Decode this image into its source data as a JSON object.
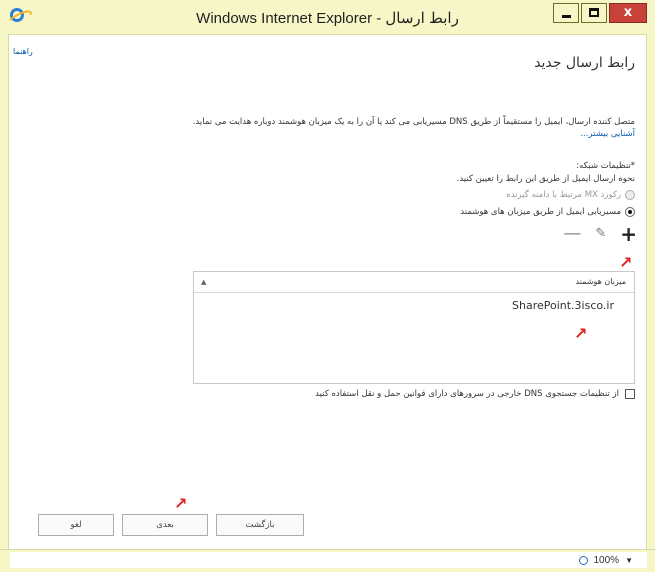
{
  "window": {
    "title": "رابط ارسال - Windows Internet Explorer",
    "min_glyph": "",
    "close_glyph": "x"
  },
  "page": {
    "help_link": "راهنما",
    "heading": "رابط ارسال جدید",
    "description": "متصل کننده ارسال، ایمیل را مستقیماً از طریق DNS مسیریابی می کند یا آن را به یک میزبان هوشمند دوباره هدایت می نماید.",
    "learn_more": "آشنایی بیشتر...",
    "network_settings_label": "*تنظیمات شبکه:",
    "network_settings_sub": "نحوه ارسال ایمیل از طریق این رابط را تعیین کنید.",
    "radio_options": [
      {
        "label": "رکورد MX مرتبط با دامنه گیرنده",
        "checked": false,
        "disabled": true
      },
      {
        "label": "مسیریابی ایمیل از طریق میزبان های هوشمند",
        "checked": true,
        "disabled": false
      }
    ],
    "toolbar": {
      "add": "+",
      "edit": "✎",
      "remove": "—"
    },
    "grid": {
      "header": "میزبان هوشمند",
      "sort_glyph": "▲",
      "rows": [
        "SharePoint.3isco.ir"
      ]
    },
    "external_dns_checkbox": {
      "label": "از تنظیمات جستجوی DNS خارجی در سرورهای دارای قوانین حمل و نقل استفاده کنید",
      "checked": false
    },
    "buttons": {
      "cancel": "لغو",
      "next": "بعدی",
      "back": "بازگشت"
    }
  },
  "statusbar": {
    "zoom": "100%",
    "dropdown_glyph": "▼"
  },
  "annotations": {
    "arrow_glyph": "↗"
  },
  "colors": {
    "link": "#0a5aa8",
    "annotation": "#e02222",
    "chrome": "#f6f6c6"
  }
}
